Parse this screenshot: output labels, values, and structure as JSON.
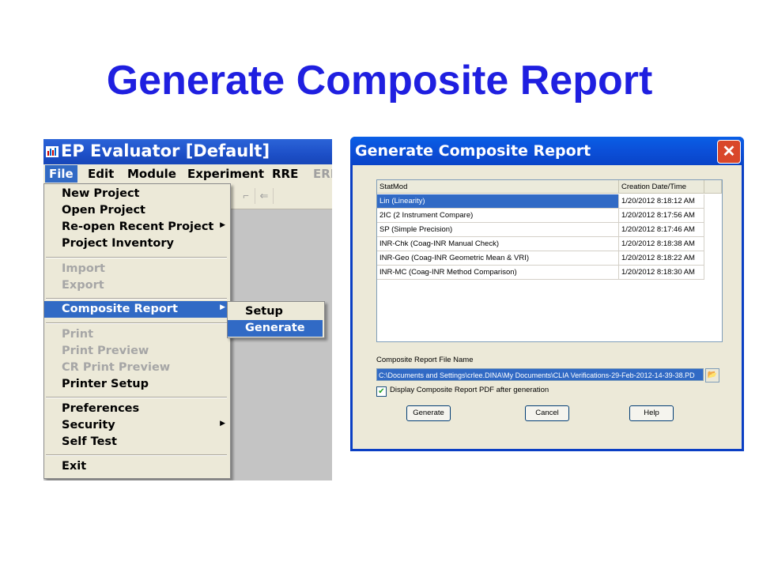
{
  "slide": {
    "title": "Generate Composite Report"
  },
  "ep_window": {
    "title": "EP Evaluator [Default]",
    "menubar": [
      "File",
      "Edit",
      "Module",
      "Experiment",
      "RRE",
      "ERI"
    ],
    "file_menu": {
      "group1": [
        "New Project",
        "Open Project",
        "Re-open Recent Project",
        "Project Inventory"
      ],
      "group2": [
        "Import",
        "Export"
      ],
      "group3": [
        "Composite Report"
      ],
      "group4": [
        "Print",
        "Print Preview",
        "CR Print Preview",
        "Printer Setup"
      ],
      "group5": [
        "Preferences",
        "Security",
        "Self Test"
      ],
      "group6": [
        "Exit"
      ]
    },
    "submenu": [
      "Setup",
      "Generate"
    ]
  },
  "dialog": {
    "title": "Generate Composite Report",
    "columns": [
      "StatMod",
      "Creation Date/Time"
    ],
    "rows": [
      [
        "Lin (Linearity)",
        "1/20/2012 8:18:12 AM"
      ],
      [
        "2IC (2 Instrument Compare)",
        "1/20/2012 8:17:56 AM"
      ],
      [
        "SP (Simple Precision)",
        "1/20/2012 8:17:46 AM"
      ],
      [
        "INR-Chk (Coag-INR Manual Check)",
        "1/20/2012 8:18:38 AM"
      ],
      [
        "INR-Geo (Coag-INR Geometric Mean & VRI)",
        "1/20/2012 8:18:22 AM"
      ],
      [
        "INR-MC (Coag-INR Method Comparison)",
        "1/20/2012 8:18:30 AM"
      ]
    ],
    "file_label": "Composite Report File Name",
    "file_value": "C:\\Documents and Settings\\crlee.DINA\\My Documents\\CLIA Verifications-29-Feb-2012-14-39-38.PD",
    "checkbox_label": "Display Composite Report PDF after generation",
    "buttons": [
      "Generate",
      "Cancel",
      "Help"
    ]
  }
}
